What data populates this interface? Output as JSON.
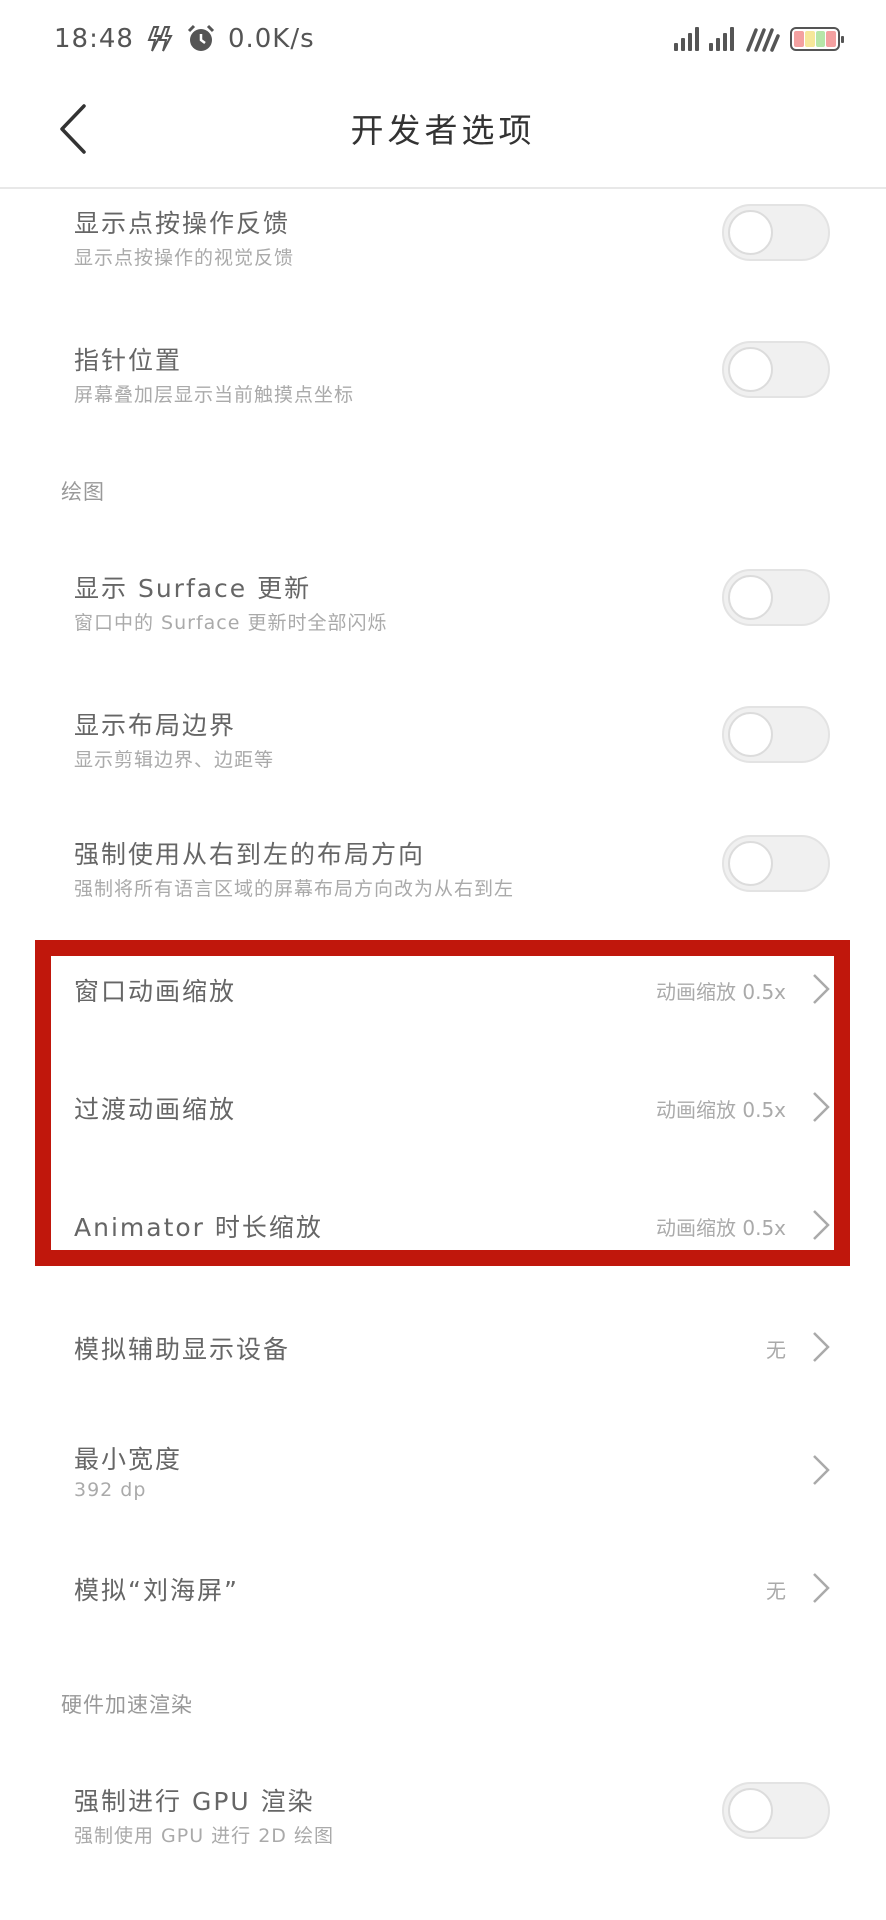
{
  "status_bar": {
    "time": "18:48",
    "speed": "0.0K/s",
    "icons": [
      "charging-bolt-icon",
      "alarm-clock-icon",
      "signal-icon",
      "signal-icon",
      "wifi-icon",
      "battery-icon"
    ]
  },
  "header": {
    "title": "开发者选项",
    "back_icon": "back-chevron-icon"
  },
  "rows": [
    {
      "title": "显示点按操作反馈",
      "subtitle": "显示点按操作的视觉反馈",
      "toggle_on": false
    },
    {
      "title": "指针位置",
      "subtitle": "屏幕叠加层显示当前触摸点坐标",
      "toggle_on": false
    }
  ],
  "section_drawing": "绘图",
  "drawing_rows": [
    {
      "title": "显示 Surface 更新",
      "subtitle": "窗口中的 Surface 更新时全部闪烁",
      "toggle_on": false
    },
    {
      "title": "显示布局边界",
      "subtitle": "显示剪辑边界、边距等",
      "toggle_on": false
    },
    {
      "title": "强制使用从右到左的布局方向",
      "subtitle": "强制将所有语言区域的屏幕布局方向改为从右到左",
      "toggle_on": false
    }
  ],
  "animation_rows": [
    {
      "title": "窗口动画缩放",
      "value": "动画缩放 0.5x"
    },
    {
      "title": "过渡动画缩放",
      "value": "动画缩放 0.5x"
    },
    {
      "title": "Animator 时长缩放",
      "value": "动画缩放 0.5x"
    }
  ],
  "display_rows": [
    {
      "title": "模拟辅助显示设备",
      "value": "无"
    },
    {
      "title": "最小宽度",
      "subtitle": "392 dp"
    },
    {
      "title": "模拟“刘海屏”",
      "value": "无"
    }
  ],
  "section_hw": "硬件加速渲染",
  "hw_rows": [
    {
      "title": "强制进行 GPU 渲染",
      "subtitle": "强制使用 GPU 进行 2D 绘图",
      "toggle_on": false
    }
  ],
  "colors": {
    "highlight": "#c0170c",
    "text": "#666666",
    "subtext": "#aaaaaa"
  }
}
